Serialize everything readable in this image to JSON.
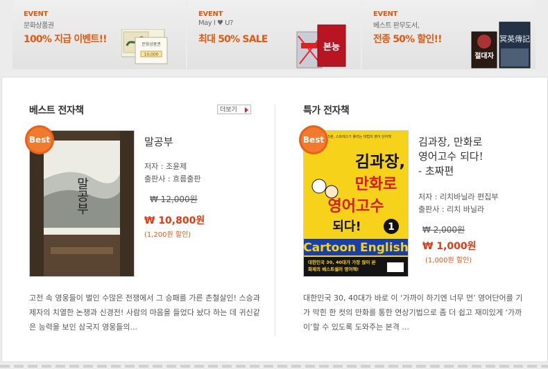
{
  "banners": [
    {
      "tag": "EVENT",
      "sub": "문화상품권",
      "title": "100% 지급 이벤트!!"
    },
    {
      "tag": "EVENT",
      "sub": "May I ♥ U?",
      "title": "최대 50% SALE"
    },
    {
      "tag": "EVENT",
      "sub": "베스트 판무도서,",
      "title": "전종 50% 할인!!"
    }
  ],
  "banner_images": {
    "voucher_text": "문화상품권",
    "voucher_amount": "10,000",
    "b2_cover": "본능",
    "b3_cover1": "절대자",
    "b3_cover2": "冥英傳記"
  },
  "best": {
    "section_title": "베스트 전자책",
    "more_label": "더보기",
    "badge": "Best",
    "cover_title": "말공부",
    "title": "말공부",
    "author": "저자 : 조윤제",
    "publisher": "출판사 : 흐름출판",
    "old_price": "₩ 12,000원",
    "new_price": "₩ 10,800원",
    "discount": "(1,200원 할인)",
    "description": "고전 속 영웅들이 벌인 수많은 전쟁에서 그 승패를 가른 촌철살인! 스승과 제자의 치열한 논쟁과 신경전! 사람의 마음을 들었다 놨다 하는 데 귀신같은 능력을 보인 삼국지 영웅들의..."
  },
  "special": {
    "section_title": "특가 전자책",
    "badge": "Best",
    "cover_top": "하루 5분, 스트레스가 풀리는 마법의 영어 단어책",
    "cover_line1": "김과장,",
    "cover_line2": "만화로",
    "cover_line3": "영어고수",
    "cover_line4": "되다!",
    "cover_num": "1",
    "cover_en": "Cartoon English",
    "cover_bottom1": "대한민국 30, 40대가 가장 많이 본",
    "cover_bottom2": "화제의 베스트셀러 영어책!",
    "title_line1": "김과장, 만화로",
    "title_line2": "영어고수 되다!",
    "title_line3": "- 초짜편",
    "author": "저자 : 리치바닐라 편집부",
    "publisher": "출판사 : 리치 바닐라",
    "old_price": "₩ 2,000원",
    "new_price": "₩ 1,000원",
    "discount": "(1,000원 할인)",
    "description": "대한민국 30, 40대가 바로 이 ‘가까이 하기엔 너무 먼’ 영어단어를 기가 막힌 한 컷의 만화를 통한 연상기법으로 좀 더 쉽고 재미있게 ‘가까이’할 수 있도록 도와주는 본격 ..."
  },
  "colors": {
    "accent": "#e05a12",
    "price": "#e03a12",
    "badge": "#e8611a"
  }
}
